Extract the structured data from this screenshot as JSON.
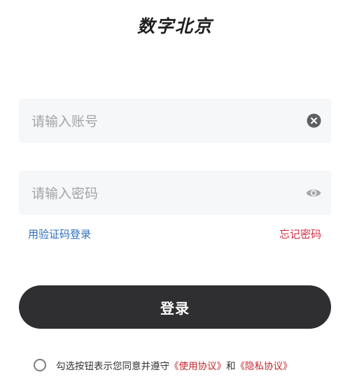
{
  "app": {
    "logo_text": "数字北京"
  },
  "login_form": {
    "account_placeholder": "请输入账号",
    "password_placeholder": "请输入密码",
    "sms_login_link": "用验证码登录",
    "forgot_password_link": "忘记密码",
    "login_button": "登录"
  },
  "agreement": {
    "prefix_text": "勾选按钮表示您同意并遵守",
    "user_agreement": "《使用协议》",
    "and_text": "和",
    "privacy_policy": "《隐私协议》"
  },
  "icons": {
    "clear": "clear-circle-icon",
    "password_visibility": "eye-icon",
    "agreement_checkbox": "radio-circle-icon"
  },
  "colors": {
    "primary_button": "#2f2f31",
    "link_blue": "#2d6fb8",
    "link_red": "#cf2e44",
    "protocol_red": "#c1272d",
    "field_bg": "#f6f7f9"
  }
}
